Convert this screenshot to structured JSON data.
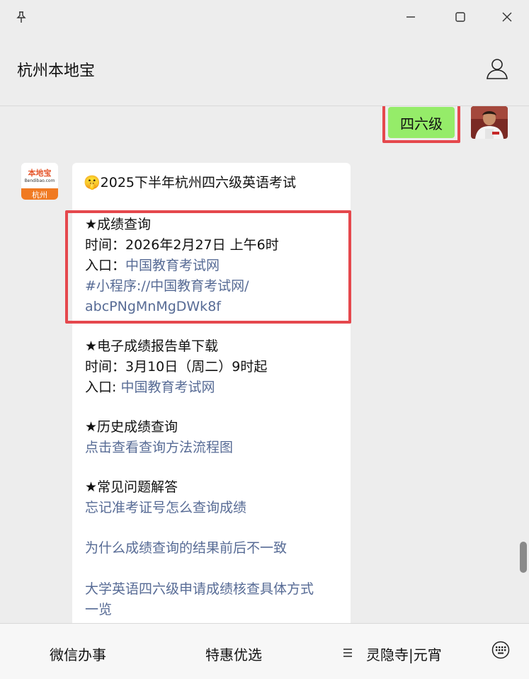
{
  "window": {
    "pin_icon": "pin-icon",
    "minimize_icon": "minimize-icon",
    "maximize_icon": "maximize-icon",
    "close_icon": "close-icon"
  },
  "header": {
    "title": "杭州本地宝",
    "user_icon": "user-profile-icon"
  },
  "chat": {
    "sent": {
      "text": "四六级",
      "bubble_color": "#95ec69"
    },
    "bot_avatar": {
      "logo_top": "本地宝",
      "logo_sub": "Bendibao.com",
      "logo_city": "杭州"
    },
    "reply": {
      "emoji": "🤫",
      "title": "2025下半年杭州四六级英语考试",
      "sections": {
        "score_query": {
          "heading": "★成绩查询",
          "time": "时间：2026年2月27日 上午6时",
          "entry_label": "入口：",
          "entry_link": "中国教育考试网",
          "mini_program_line1": "#小程序://中国教育考试网/",
          "mini_program_line2": "abcPNgMnMgDWk8f"
        },
        "report_download": {
          "heading": "★电子成绩报告单下载",
          "time": "时间：3月10日（周二）9时起",
          "entry_label": "入口: ",
          "entry_link": "中国教育考试网"
        },
        "history_query": {
          "heading": "★历史成绩查询",
          "link": "点击查看查询方法流程图"
        },
        "faq": {
          "heading": "★常见问题解答",
          "link1": "忘记准考证号怎么查询成绩",
          "link2": "为什么成绩查询的结果前后不一致",
          "link3_line1": "大学英语四六级申请成绩核查具体方式",
          "link3_line2": "一览"
        }
      },
      "link_color": "#576b95"
    },
    "highlight_color": "#e5484d"
  },
  "bottom_menu": {
    "item1": "微信办事",
    "item2": "特惠优选",
    "item3_icon": "menu-lines-icon",
    "item3": "灵隐寺|元宵",
    "keyboard_icon": "keyboard-icon"
  }
}
